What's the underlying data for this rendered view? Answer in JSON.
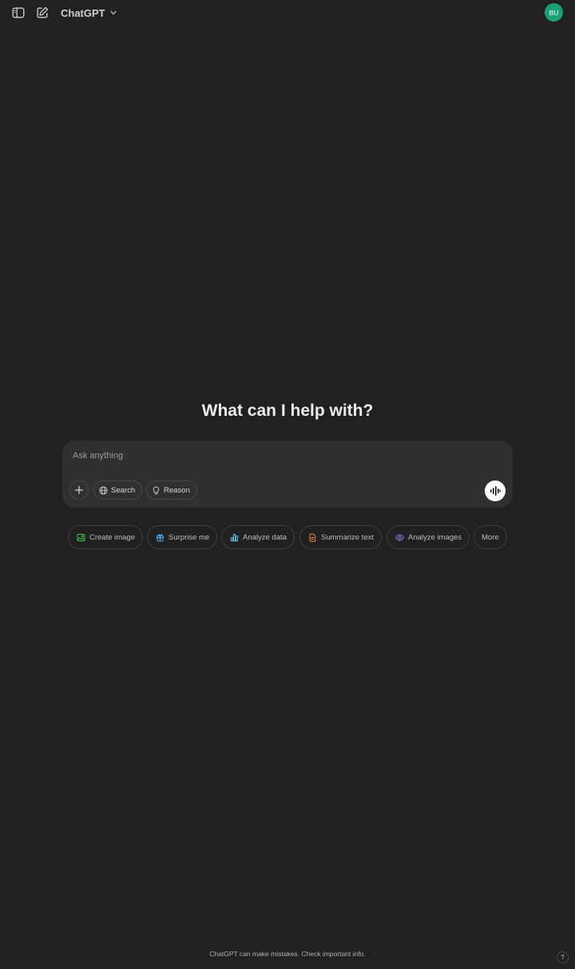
{
  "header": {
    "title": "ChatGPT",
    "avatar_initials": "BU"
  },
  "main": {
    "heading": "What can I help with?"
  },
  "composer": {
    "placeholder": "Ask anything",
    "tools": [
      {
        "label": "Search",
        "icon": "globe-icon"
      },
      {
        "label": "Reason",
        "icon": "lightbulb-icon"
      }
    ]
  },
  "suggestions": [
    {
      "label": "Create image",
      "icon": "image-icon",
      "color": "#3fbf5c"
    },
    {
      "label": "Surprise me",
      "icon": "gift-icon",
      "color": "#5aa7e6"
    },
    {
      "label": "Analyze data",
      "icon": "bar-chart-icon",
      "color": "#5ac0e6"
    },
    {
      "label": "Summarize text",
      "icon": "document-icon",
      "color": "#e8864a"
    },
    {
      "label": "Analyze images",
      "icon": "eye-icon",
      "color": "#8c7cf0"
    },
    {
      "label": "More",
      "icon": "",
      "color": ""
    }
  ],
  "footer": {
    "disclaimer": "ChatGPT can make mistakes. Check important info.",
    "help_label": "?"
  },
  "colors": {
    "background": "#212121",
    "composer": "#303030",
    "avatar": "#19a078"
  }
}
